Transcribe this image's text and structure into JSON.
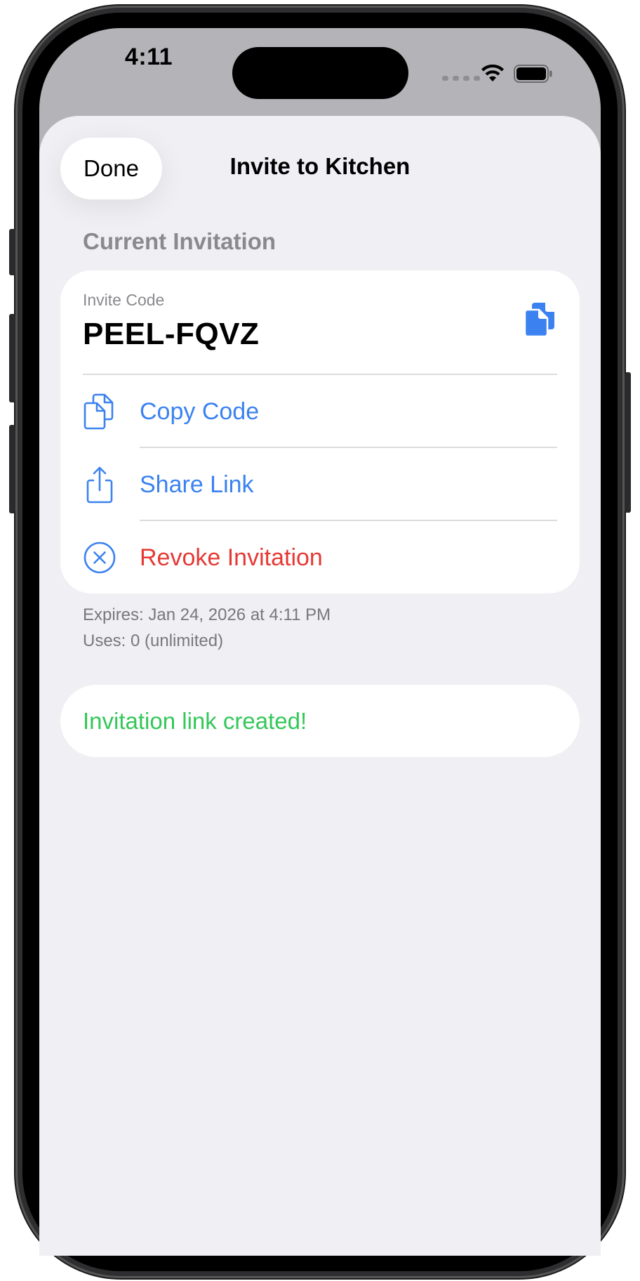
{
  "status_bar": {
    "time": "4:11"
  },
  "sheet": {
    "done_label": "Done",
    "title": "Invite to Kitchen"
  },
  "current_invitation": {
    "section_header": "Current Invitation",
    "code_label": "Invite Code",
    "code_value": "PEEL-FQVZ",
    "actions": [
      {
        "label": "Copy Code",
        "icon": "doc-on-doc-icon"
      },
      {
        "label": "Share Link",
        "icon": "share-icon"
      },
      {
        "label": "Revoke Invitation",
        "icon": "xmark-circle-icon"
      }
    ],
    "expires": "Expires: Jan 24, 2026 at 4:11 PM",
    "uses": "Uses: 0 (unlimited)"
  },
  "success_message": "Invitation link created!",
  "colors": {
    "accent": "#3b82f0",
    "destructive": "#e53935",
    "success": "#34c759",
    "sheet_background": "#efeff4"
  }
}
